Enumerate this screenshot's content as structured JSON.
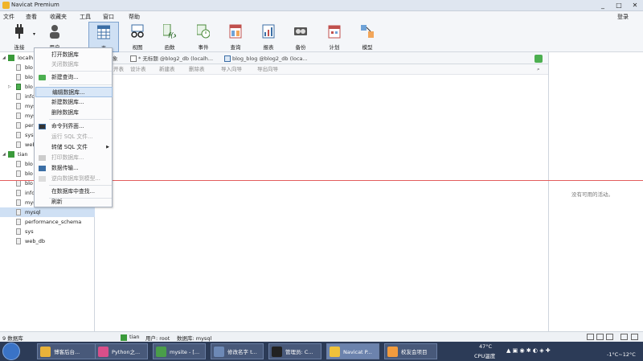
{
  "window": {
    "title": "Navicat Premium",
    "controls": [
      "_",
      "□",
      "✕"
    ]
  },
  "menubar": {
    "items": [
      "文件",
      "查看",
      "收藏夹",
      "工具",
      "窗口",
      "帮助"
    ],
    "login": "登录"
  },
  "toolbar": {
    "items": [
      {
        "label": "连接",
        "icon": "plug-icon"
      },
      {
        "label": "用户",
        "icon": "user-icon"
      },
      {
        "label": "表",
        "icon": "table-icon"
      },
      {
        "label": "视图",
        "icon": "glasses-icon"
      },
      {
        "label": "函数",
        "icon": "function-icon"
      },
      {
        "label": "事件",
        "icon": "event-icon"
      },
      {
        "label": "查询",
        "icon": "query-icon"
      },
      {
        "label": "报表",
        "icon": "report-icon"
      },
      {
        "label": "备份",
        "icon": "backup-icon"
      },
      {
        "label": "计划",
        "icon": "calendar-icon"
      },
      {
        "label": "模型",
        "icon": "model-icon"
      }
    ],
    "active": "表"
  },
  "nav": {
    "rows": [
      {
        "type": "conn",
        "text": "localh"
      },
      {
        "type": "db",
        "text": "blo"
      },
      {
        "type": "db",
        "text": "blo"
      },
      {
        "type": "db-open",
        "text": "blo"
      },
      {
        "type": "db",
        "text": "info"
      },
      {
        "type": "db",
        "text": "mys"
      },
      {
        "type": "db",
        "text": "mys"
      },
      {
        "type": "db",
        "text": "per"
      },
      {
        "type": "db",
        "text": "sys"
      },
      {
        "type": "db",
        "text": "web"
      },
      {
        "type": "conn",
        "text": "tian"
      },
      {
        "type": "db",
        "text": "blo"
      },
      {
        "type": "db",
        "text": "blo"
      },
      {
        "type": "db",
        "text": "blo"
      },
      {
        "type": "db",
        "text": "info"
      },
      {
        "type": "db",
        "text": "mys"
      },
      {
        "type": "db-sel",
        "text": "mysql"
      },
      {
        "type": "db",
        "text": "performance_schema"
      },
      {
        "type": "db",
        "text": "sys"
      },
      {
        "type": "db",
        "text": "web_db"
      }
    ]
  },
  "tabs": [
    {
      "label": "象"
    },
    {
      "label": "* 无标题 @blog2_db (localh..."
    },
    {
      "label": "blog_blog @blog2_db (loca..."
    }
  ],
  "object_toolbar": [
    "开表",
    "设计表",
    "新建表",
    "删除表",
    "导入向导",
    "导出向导"
  ],
  "info_panel": {
    "empty_text": "没有可用的活动。"
  },
  "context_menu": {
    "items": [
      {
        "label": "打开数据库",
        "enabled": true
      },
      {
        "label": "关闭数据库",
        "enabled": false
      },
      {
        "sep": true
      },
      {
        "label": "新建查询...",
        "enabled": true,
        "icon": "new-query-icon"
      },
      {
        "sep": true
      },
      {
        "label": "编辑数据库...",
        "enabled": true,
        "highlight": true
      },
      {
        "label": "新建数据库...",
        "enabled": true
      },
      {
        "label": "删除数据库",
        "enabled": true
      },
      {
        "sep": true
      },
      {
        "label": "命令列界面...",
        "enabled": true,
        "icon": "console-icon"
      },
      {
        "label": "运行 SQL 文件...",
        "enabled": false
      },
      {
        "label": "转储 SQL 文件",
        "enabled": true,
        "submenu": true
      },
      {
        "label": "打印数据库...",
        "enabled": false,
        "icon": "print-icon"
      },
      {
        "label": "数据传输...",
        "enabled": true,
        "icon": "transfer-icon"
      },
      {
        "label": "逆向数据库到模型...",
        "enabled": false,
        "icon": "model-small-icon"
      },
      {
        "sep": true
      },
      {
        "label": "在数据库中查找...",
        "enabled": true
      },
      {
        "sep": true
      },
      {
        "label": "刷新",
        "enabled": true
      }
    ]
  },
  "statusbar": {
    "left": "9 数据库",
    "conn": "tian",
    "user": "用户: root",
    "db": "数据库: mysql"
  },
  "taskbar": {
    "items": [
      {
        "label": "博客后台...",
        "color": "#e8b23a"
      },
      {
        "label": "Python之...",
        "color": "#d94f8a"
      },
      {
        "label": "mysite - [...",
        "color": "#4a9d4a"
      },
      {
        "label": "修改名字 t...",
        "color": "#6d89b6"
      },
      {
        "label": "管理员: C...",
        "color": "#222222"
      },
      {
        "label": "Navicat P...",
        "color": "#f0c23a",
        "active": true
      },
      {
        "label": "校友会项目",
        "color": "#f29b3d"
      }
    ],
    "temp": "47°C",
    "cpu": "CPU温度",
    "weather": "-1°C~12°C"
  }
}
